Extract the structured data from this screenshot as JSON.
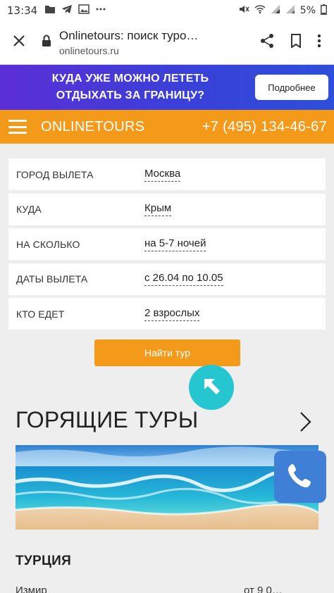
{
  "status_bar": {
    "time": "13:34",
    "battery": "5%",
    "icons_left": [
      "folder-icon",
      "telegram-icon",
      "image-icon",
      "more-dots-icon"
    ],
    "icons_right": [
      "mute-icon",
      "wifi-icon",
      "signal-icon",
      "signal-icon",
      "battery-icon"
    ]
  },
  "browser": {
    "page_title": "Onlinetours: поиск туро…",
    "url": "onlinetours.ru"
  },
  "banner": {
    "text": "КУДА УЖЕ МОЖНО ЛЕТЕТЬ ОТДЫХАТЬ ЗА ГРАНИЦУ?",
    "button_label": "Подробнее"
  },
  "header": {
    "brand": "ONLINETOURS",
    "phone": "+7 (495) 134-46-67"
  },
  "search_form": {
    "rows": [
      {
        "label": "ГОРОД ВЫЛЕТА",
        "value": "Москва"
      },
      {
        "label": "КУДА",
        "value": "Крым"
      },
      {
        "label": "НА СКОЛЬКО",
        "value": "на 5-7 ночей"
      },
      {
        "label": "ДАТЫ ВЫЛЕТА",
        "value": "с 26.04 по 10.05"
      },
      {
        "label": "КТО ЕДЕТ",
        "value": "2 взрослых"
      }
    ],
    "submit_label": "Найти тур"
  },
  "hot_tours": {
    "title": "ГОРЯЩИЕ ТУРЫ",
    "country": "ТУРЦИЯ",
    "partial_left": "Измир",
    "partial_right": "от 9 0…"
  },
  "colors": {
    "accent_orange": "#f39a1a",
    "banner_purple": "#5b2fd6",
    "fab_teal": "#26c6d0",
    "phone_blue": "#3f7fd6"
  }
}
